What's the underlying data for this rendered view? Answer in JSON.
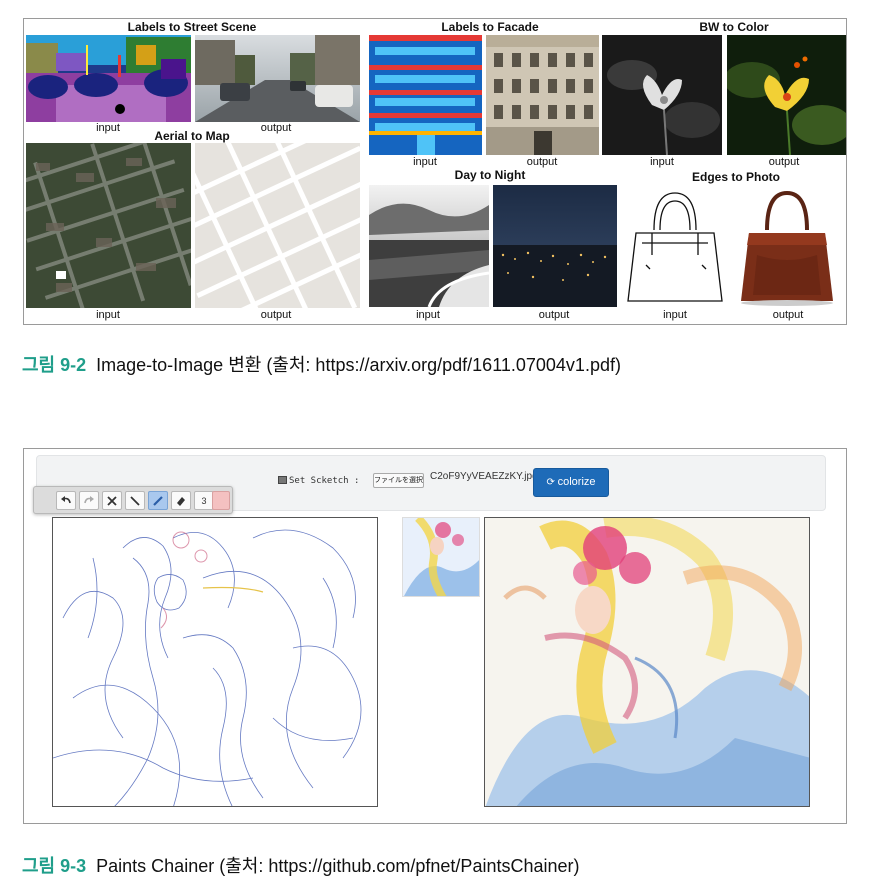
{
  "figure1": {
    "panels": {
      "street": {
        "title": "Labels to Street Scene",
        "input": "input",
        "output": "output"
      },
      "facade": {
        "title": "Labels to Facade",
        "input": "input",
        "output": "output"
      },
      "bw": {
        "title": "BW to Color",
        "input": "input",
        "output": "output"
      },
      "aerial": {
        "title": "Aerial to Map",
        "input": "input",
        "output": "output"
      },
      "daynight": {
        "title": "Day to Night",
        "input": "input",
        "output": "output"
      },
      "edges": {
        "title": "Edges to Photo",
        "input": "input",
        "output": "output"
      }
    },
    "caption_number": "그림 9-2",
    "caption_text": "Image-to-Image 변환 (출처: https://arxiv.org/pdf/1611.07004v1.pdf)"
  },
  "figure2": {
    "app": {
      "set_label": "Set Scketch :",
      "file_button": "ファイルを選択",
      "file_name": "C2oF9YyVEAEZzKY.jpg",
      "colorize_label": "colorize"
    },
    "toolbar": {
      "tools": [
        "undo-icon",
        "redo-icon",
        "clear-icon",
        "line-icon",
        "pen-icon",
        "eraser-icon",
        "brush-size",
        "color-swatch"
      ],
      "brush_size": "3",
      "swatch_color": "#f4c1c1",
      "active_color": "#a9c8ee"
    },
    "caption_number": "그림 9-3",
    "caption_text": "Paints Chainer (출처: https://github.com/pfnet/PaintsChainer)"
  },
  "colors": {
    "caption_accent": "#1f9e8a",
    "colorize_button": "#1e6bb8"
  }
}
